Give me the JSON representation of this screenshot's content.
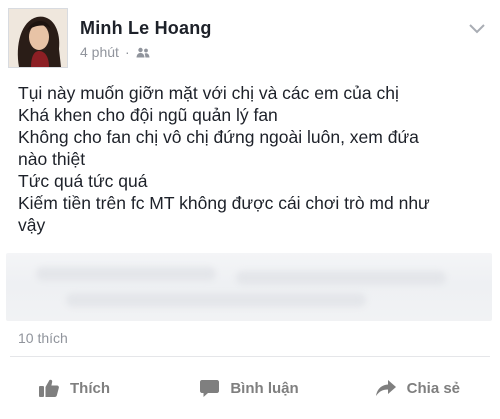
{
  "post": {
    "author": "Minh Le Hoang",
    "time": "4 phút",
    "separator": "·",
    "audience_icon": "friends-icon",
    "menu_icon": "chevron-down-icon",
    "lines": [
      "Tụi này muốn giỡn mặt với chị và các em của chị",
      "Khá khen cho đội ngũ quản lý fan",
      "Không cho fan chị vô chị đứng ngoài luôn, xem đứa",
      "nào thiệt",
      "Tức quá tức quá",
      "Kiếm tiền trên fc MT không được cái chơi trò md như",
      "vậy"
    ],
    "likes": "10 thích"
  },
  "actions": {
    "like": {
      "label": "Thích",
      "icon": "thumbs-up-icon"
    },
    "comment": {
      "label": "Bình luận",
      "icon": "comment-icon"
    },
    "share": {
      "label": "Chia sẻ",
      "icon": "share-arrow-icon"
    }
  },
  "colors": {
    "text": "#1d2129",
    "meta": "#90949c",
    "action": "#7f7f7f",
    "divider": "#e5e6e9"
  }
}
